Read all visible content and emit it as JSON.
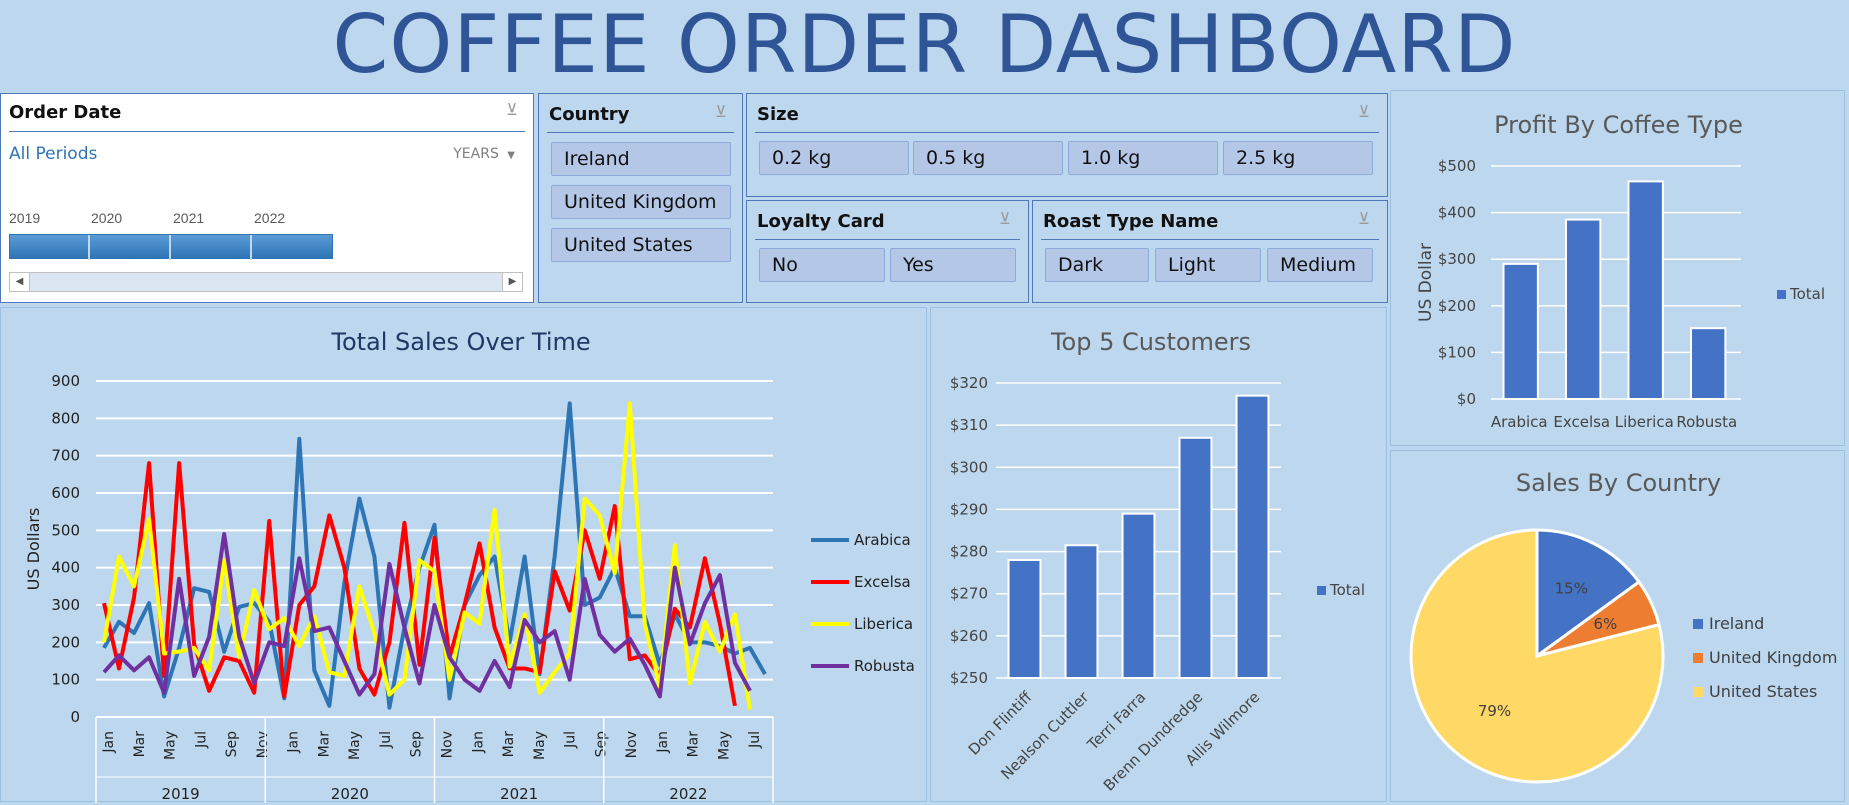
{
  "title": "COFFEE ORDER DASHBOARD",
  "order_date": {
    "heading": "Order Date",
    "periods": "All Periods",
    "level": "YEARS",
    "years": [
      "2019",
      "2020",
      "2021",
      "2022"
    ]
  },
  "country_slicer": {
    "heading": "Country",
    "items": [
      "Ireland",
      "United Kingdom",
      "United States"
    ]
  },
  "size_slicer": {
    "heading": "Size",
    "items": [
      "0.2 kg",
      "0.5 kg",
      "1.0 kg",
      "2.5 kg"
    ]
  },
  "loyalty_slicer": {
    "heading": "Loyalty Card",
    "items": [
      "No",
      "Yes"
    ]
  },
  "roast_slicer": {
    "heading": "Roast Type Name",
    "items": [
      "Dark",
      "Light",
      "Medium"
    ]
  },
  "colors": {
    "arabica": "#2e75b6",
    "excelsa": "#ff0000",
    "liberica": "#ffff00",
    "robusta": "#7030a0",
    "bar": "#4472c4",
    "ireland": "#4472c4",
    "uk": "#ed7d31",
    "us": "#ffd966"
  },
  "chart_data": [
    {
      "type": "line",
      "title": "Total Sales Over Time",
      "ylabel": "US Dollars",
      "ylim": [
        0,
        900
      ],
      "yticks": [
        0,
        100,
        200,
        300,
        400,
        500,
        600,
        700,
        800,
        900
      ],
      "month_labels": [
        "Jan",
        "Mar",
        "May",
        "Jul",
        "Sep",
        "Nov",
        "Jan",
        "Mar",
        "May",
        "Jul",
        "Sep",
        "Nov",
        "Jan",
        "Mar",
        "May",
        "Jul",
        "Sep",
        "Nov",
        "Jan",
        "Mar",
        "May",
        "Jul"
      ],
      "year_labels": [
        "2019",
        "2020",
        "2021",
        "2022"
      ],
      "series": [
        {
          "name": "Arabica",
          "values": [
            185,
            255,
            225,
            305,
            55,
            185,
            345,
            335,
            175,
            295,
            305,
            255,
            50,
            745,
            125,
            30,
            360,
            585,
            430,
            25,
            240,
            400,
            515,
            50,
            300,
            380,
            430,
            200,
            430,
            115,
            430,
            840,
            300,
            320,
            400,
            270,
            270,
            140,
            275,
            200,
            200,
            190,
            170,
            185,
            115
          ]
        },
        {
          "name": "Excelsa",
          "values": [
            305,
            130,
            320,
            680,
            110,
            680,
            195,
            70,
            160,
            150,
            65,
            525,
            55,
            300,
            350,
            540,
            400,
            130,
            60,
            200,
            520,
            140,
            480,
            160,
            300,
            465,
            240,
            130,
            130,
            120,
            390,
            285,
            500,
            370,
            565,
            155,
            165,
            110,
            290,
            240,
            425,
            250,
            30
          ]
        },
        {
          "name": "Liberica",
          "values": [
            200,
            430,
            350,
            530,
            170,
            175,
            185,
            125,
            420,
            160,
            340,
            235,
            265,
            190,
            270,
            120,
            110,
            350,
            225,
            60,
            100,
            420,
            390,
            100,
            280,
            250,
            555,
            135,
            275,
            65,
            120,
            170,
            585,
            540,
            385,
            840,
            250,
            80,
            460,
            90,
            255,
            175,
            275,
            20
          ]
        },
        {
          "name": "Robusta",
          "values": [
            120,
            165,
            125,
            160,
            65,
            370,
            110,
            215,
            490,
            215,
            90,
            200,
            190,
            425,
            230,
            240,
            150,
            60,
            115,
            410,
            240,
            90,
            300,
            160,
            100,
            70,
            150,
            80,
            260,
            200,
            230,
            100,
            370,
            220,
            175,
            210,
            140,
            55,
            400,
            195,
            305,
            380,
            145,
            70
          ]
        }
      ]
    },
    {
      "type": "bar",
      "title": "Top 5 Customers",
      "categories": [
        "Don Flintiff",
        "Nealson Cuttler",
        "Terri Farra",
        "Brenn Dundredge",
        "Allis Wilmore"
      ],
      "values": [
        278,
        281.5,
        289,
        307,
        317
      ],
      "ylim": [
        250,
        320
      ],
      "yticks": [
        "$250",
        "$260",
        "$270",
        "$280",
        "$290",
        "$300",
        "$310",
        "$320"
      ],
      "legend": "Total"
    },
    {
      "type": "bar",
      "title": "Profit By Coffee Type",
      "categories": [
        "Arabica",
        "Excelsa",
        "Liberica",
        "Robusta"
      ],
      "values": [
        290,
        385,
        467,
        152
      ],
      "ylim": [
        0,
        500
      ],
      "yticks": [
        "$0",
        "$100",
        "$200",
        "$300",
        "$400",
        "$500"
      ],
      "ylabel": "US Dollar",
      "legend": "Total"
    },
    {
      "type": "pie",
      "title": "Sales By Country",
      "categories": [
        "Ireland",
        "United Kingdom",
        "United States"
      ],
      "values": [
        15,
        6,
        79
      ],
      "labels": [
        "15%",
        "6%",
        "79%"
      ]
    }
  ]
}
